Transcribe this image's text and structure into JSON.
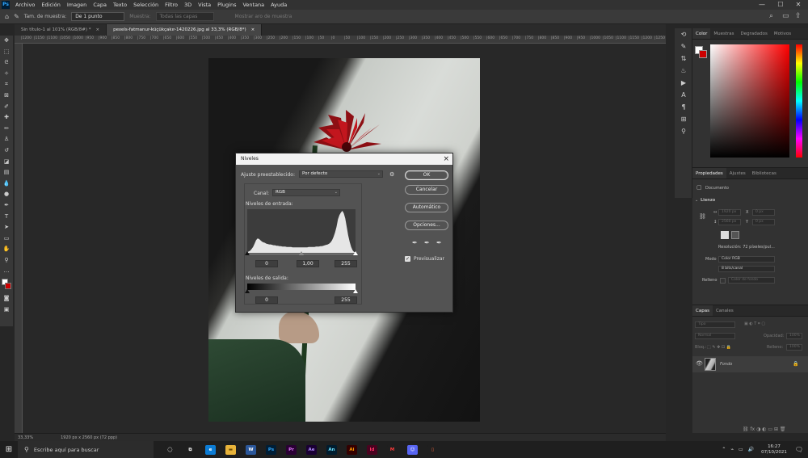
{
  "app": {
    "logo": "Ps"
  },
  "menu": [
    "Archivo",
    "Edición",
    "Imagen",
    "Capa",
    "Texto",
    "Selección",
    "Filtro",
    "3D",
    "Vista",
    "Plugins",
    "Ventana",
    "Ayuda"
  ],
  "window_controls": {
    "minimize": "—",
    "maximize": "☐",
    "close": "✕"
  },
  "options_bar": {
    "sample_size_label": "Tam. de muestra:",
    "sample_size_value": "De 1 punto",
    "sample_label": "Muestra:",
    "sample_value": "Todas las capas",
    "show_ring": "Mostrar aro de muestra"
  },
  "tabs": [
    {
      "label": "Sin título-1 al 101% (RGB/8#) *",
      "close": "×"
    },
    {
      "label": "pexels-fatmanur-küçükçakır-1420226.jpg al 33,3% (RGB/8*)",
      "close": "×"
    }
  ],
  "ruler_ticks": [
    "|1200",
    "|1150",
    "|1100",
    "|1050",
    "|1000",
    "|950",
    "|900",
    "|850",
    "|800",
    "|750",
    "|700",
    "|650",
    "|600",
    "|550",
    "|500",
    "|450",
    "|400",
    "|350",
    "|300",
    "|250",
    "|200",
    "|150",
    "|100",
    "|50",
    "|0",
    "|50",
    "|100",
    "|150",
    "|200",
    "|250",
    "|300",
    "|350",
    "|400",
    "|450",
    "|500",
    "|550",
    "|600",
    "|650",
    "|700",
    "|750",
    "|800",
    "|850",
    "|900",
    "|950",
    "|1000",
    "|1050",
    "|1100",
    "|1150",
    "|1200",
    "|1250",
    "|1300",
    "|1350",
    "|1400",
    "|1450",
    "|1500",
    "|1550",
    "|1600",
    "|1650",
    "|1700",
    "|1750",
    "|1800",
    "|1850",
    "|1900",
    "|1950",
    "|2000",
    "|2050",
    "|2100",
    "|2150",
    "|2200",
    "|2250",
    "|2300",
    "|2350",
    "|2400",
    "|2450",
    "|2500",
    "|2550",
    "|2600",
    "|2650",
    "|2700",
    "|2750",
    "|2800",
    "|2850",
    "|2900",
    "|2950",
    "|3000"
  ],
  "status": {
    "zoom": "33,33%",
    "doc": "1920 px x 2560 px (72 ppp)"
  },
  "right_tabs": {
    "color": "Color",
    "swatches": "Muestras",
    "gradients": "Degradados",
    "patterns": "Motivos"
  },
  "properties": {
    "tabs": [
      "Propiedades",
      "Ajustes",
      "Bibliotecas"
    ],
    "doc_label": "Documento",
    "canvas_label": "Lienzo",
    "w": "1920 px",
    "h": "2560 px",
    "x": "0 px",
    "y": "0 px",
    "resolution": "Resolución: 72 píxeles/pul...",
    "mode_label": "Modo",
    "mode_value": "Color RGB",
    "bits_value": "8 bits/canal",
    "fill_label": "Relleno",
    "fill_value": "Color de fondo"
  },
  "layers": {
    "tabs": [
      "Capas",
      "Canales"
    ],
    "kind": "Tipo",
    "blend": "Normal",
    "opacity_label": "Opacidad:",
    "opacity_value": "100%",
    "lock_label": "Bloq.:",
    "fill_label": "Relleno:",
    "fill_value": "100%",
    "layer_name": "Fondo"
  },
  "dialog": {
    "title": "Niveles",
    "preset_label": "Ajuste preestablecido:",
    "preset_value": "Por defecto",
    "channel_label": "Canal:",
    "channel_value": "RGB",
    "input_label": "Niveles de entrada:",
    "input_values": [
      "0",
      "1,00",
      "255"
    ],
    "output_label": "Niveles de salida:",
    "output_values": [
      "0",
      "255"
    ],
    "buttons": {
      "ok": "OK",
      "cancel": "Cancelar",
      "auto": "Automático",
      "options": "Opciones..."
    },
    "preview": "Previsualizar",
    "preview_checked": true,
    "histogram": [
      2,
      3,
      5,
      9,
      14,
      22,
      30,
      34,
      33,
      30,
      27,
      25,
      24,
      22,
      21,
      20,
      20,
      19,
      18,
      18,
      17,
      17,
      16,
      16,
      15,
      15,
      15,
      14,
      14,
      14,
      14,
      13,
      13,
      13,
      13,
      13,
      13,
      13,
      13,
      13,
      13,
      13,
      14,
      14,
      14,
      14,
      14,
      15,
      15,
      15,
      16,
      16,
      17,
      18,
      19,
      20,
      22,
      25,
      30,
      38,
      48,
      62,
      80,
      90,
      96,
      100,
      94,
      82,
      62,
      42,
      26,
      14,
      6,
      2,
      1
    ]
  },
  "taskbar": {
    "search": "Escribe aquí para buscar",
    "apps": [
      {
        "label": "◯",
        "bg": "#1f1f1f",
        "fg": "#eee"
      },
      {
        "label": "⧉",
        "bg": "#1f1f1f",
        "fg": "#eee"
      },
      {
        "label": "e",
        "bg": "#0c7cd5",
        "fg": "#fff"
      },
      {
        "label": "▬",
        "bg": "#e8b33a",
        "fg": "#6b4a00"
      },
      {
        "label": "W",
        "bg": "#2b579a",
        "fg": "#fff"
      },
      {
        "label": "Ps",
        "bg": "#001e36",
        "fg": "#31a8ff"
      },
      {
        "label": "Pr",
        "bg": "#2a0034",
        "fg": "#e27bff"
      },
      {
        "label": "Ae",
        "bg": "#1a0034",
        "fg": "#b18cff"
      },
      {
        "label": "An",
        "bg": "#001c2e",
        "fg": "#6ae0ff"
      },
      {
        "label": "Ai",
        "bg": "#330000",
        "fg": "#ff9a00"
      },
      {
        "label": "Id",
        "bg": "#49021f",
        "fg": "#ff3366"
      },
      {
        "label": "M",
        "bg": "#1f1f1f",
        "fg": "#ff3a3a"
      },
      {
        "label": "☺",
        "bg": "#5865f2",
        "fg": "#fff"
      },
      {
        "label": "▯",
        "bg": "#1f1f1f",
        "fg": "#ff6a3d"
      }
    ],
    "time": "16:27",
    "date": "07/10/2021"
  },
  "colors": {
    "foreground": "#ffffff",
    "background": "#cc0000"
  }
}
